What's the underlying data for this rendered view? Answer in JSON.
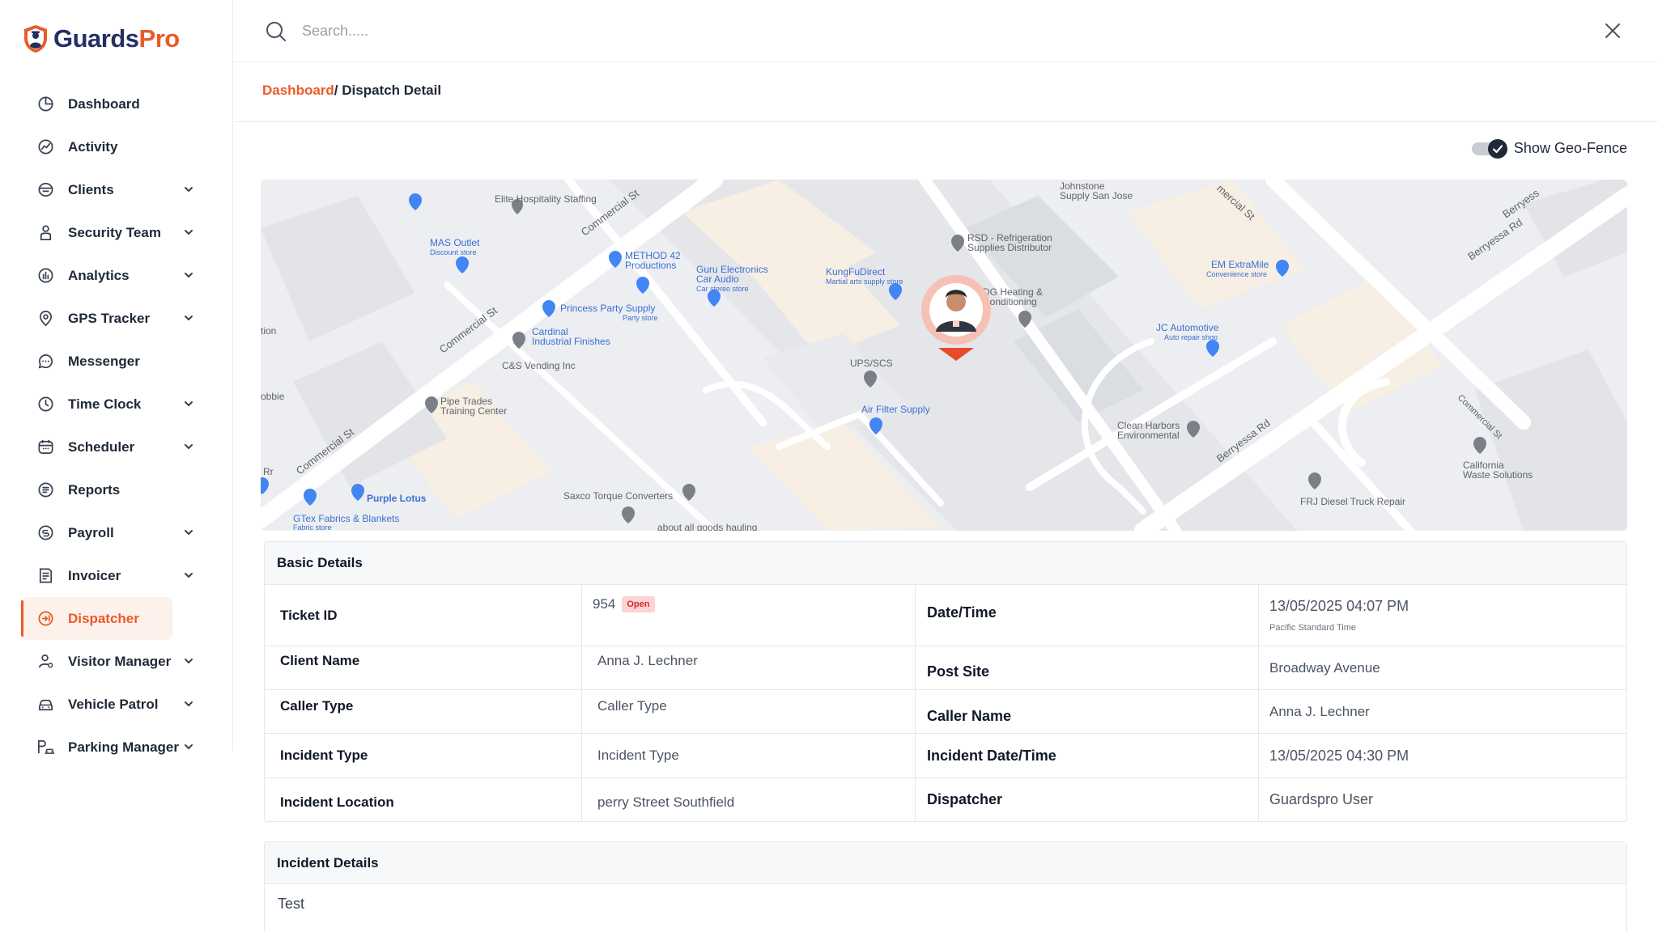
{
  "app": {
    "brand_main": "Guards",
    "brand_accent": "Pro",
    "accent_color": "#ea5a2a",
    "brand_color": "#243063"
  },
  "sidebar": {
    "items": [
      {
        "label": "Dashboard",
        "icon": "dashboard-icon",
        "has_submenu": false
      },
      {
        "label": "Activity",
        "icon": "activity-icon",
        "has_submenu": false
      },
      {
        "label": "Clients",
        "icon": "clients-icon",
        "has_submenu": true
      },
      {
        "label": "Security Team",
        "icon": "security-team-icon",
        "has_submenu": true
      },
      {
        "label": "Analytics",
        "icon": "analytics-icon",
        "has_submenu": true
      },
      {
        "label": "GPS Tracker",
        "icon": "gps-tracker-icon",
        "has_submenu": true
      },
      {
        "label": "Messenger",
        "icon": "messenger-icon",
        "has_submenu": false
      },
      {
        "label": "Time Clock",
        "icon": "time-clock-icon",
        "has_submenu": true
      },
      {
        "label": "Scheduler",
        "icon": "scheduler-icon",
        "has_submenu": true
      },
      {
        "label": "Reports",
        "icon": "reports-icon",
        "has_submenu": false
      },
      {
        "label": "Payroll",
        "icon": "payroll-icon",
        "has_submenu": true
      },
      {
        "label": "Invoicer",
        "icon": "invoicer-icon",
        "has_submenu": true
      },
      {
        "label": "Dispatcher",
        "icon": "dispatcher-icon",
        "has_submenu": false,
        "active": true
      },
      {
        "label": "Visitor Manager",
        "icon": "visitor-manager-icon",
        "has_submenu": true
      },
      {
        "label": "Vehicle Patrol",
        "icon": "vehicle-patrol-icon",
        "has_submenu": true
      },
      {
        "label": "Parking Manager",
        "icon": "parking-manager-icon",
        "has_submenu": true
      }
    ]
  },
  "search": {
    "placeholder": "Search.....",
    "value": ""
  },
  "breadcrumb": {
    "root": "Dashboard",
    "separator": "/",
    "current": " Dispatch Detail"
  },
  "geofence": {
    "label": "Show Geo-Fence",
    "checked": true
  },
  "map": {
    "streets": [
      "Commercial St",
      "Commercial St",
      "Commercial St",
      "Commercial St",
      "Berryessa Rd",
      "Berryess",
      "Berryessa Rd",
      "Commercial St"
    ],
    "places": [
      {
        "name": "Elite Hospitality Staffing",
        "sub": ""
      },
      {
        "name": "MAS Outlet",
        "sub": "Discount store"
      },
      {
        "name": "METHOD 42 Productions",
        "sub": ""
      },
      {
        "name": "Guru Electronics Car Audio",
        "sub": "Car stereo store"
      },
      {
        "name": "Princess Party Supply",
        "sub": "Party store"
      },
      {
        "name": "Cardinal Industrial Finishes",
        "sub": ""
      },
      {
        "name": "C&S Vending Inc",
        "sub": ""
      },
      {
        "name": "Pipe Trades Training Center",
        "sub": ""
      },
      {
        "name": "Purple Lotus",
        "sub": ""
      },
      {
        "name": "GTex Fabrics & Blankets",
        "sub": "Fabric store"
      },
      {
        "name": "Saxco Torque Converters",
        "sub": ""
      },
      {
        "name": "about all goods hauling",
        "sub": ""
      },
      {
        "name": "KungFuDirect",
        "sub": "Martial arts supply store"
      },
      {
        "name": "UPS/SCS",
        "sub": ""
      },
      {
        "name": "Air Filter Supply",
        "sub": ""
      },
      {
        "name": "RSD - Refrigeration Supplies Distributor",
        "sub": ""
      },
      {
        "name": "Johnstone Supply San Jose",
        "sub": ""
      },
      {
        "name": "DG Heating & Conditioning",
        "sub": ""
      },
      {
        "name": "EM ExtraMile",
        "sub": "Convenience store"
      },
      {
        "name": "JC Automotive",
        "sub": "Auto repair shop"
      },
      {
        "name": "Clean Harbors Environmental",
        "sub": ""
      },
      {
        "name": "California Waste Solutions",
        "sub": ""
      },
      {
        "name": "FRJ Diesel Truck Repair",
        "sub": ""
      },
      {
        "name": "tion",
        "sub": ""
      },
      {
        "name": "obbie",
        "sub": ""
      },
      {
        "name": "Rr",
        "sub": ""
      },
      {
        "name": "mercial St",
        "sub": ""
      }
    ]
  },
  "basic_details": {
    "title": "Basic Details",
    "ticket_id_label": "Ticket ID",
    "ticket_id": "954",
    "status": "Open",
    "datetime_label": "Date/Time",
    "datetime": "13/05/2025 04:07 PM",
    "timezone": "Pacific Standard Time",
    "client_name_label": "Client Name",
    "client_name": "Anna J. Lechner",
    "post_site_label": "Post Site",
    "post_site": "Broadway Avenue",
    "caller_type_label": "Caller Type",
    "caller_type": "Caller Type",
    "caller_name_label": "Caller Name",
    "caller_name": "Anna J. Lechner",
    "incident_type_label": "Incident Type",
    "incident_type": "Incident Type",
    "incident_datetime_label": "Incident Date/Time",
    "incident_datetime": "13/05/2025 04:30 PM",
    "incident_location_label": "Incident Location",
    "incident_location": "perry Street Southfield",
    "dispatcher_label": "Dispatcher",
    "dispatcher": "Guardspro User"
  },
  "incident_details": {
    "title": "Incident Details",
    "text": "Test"
  }
}
